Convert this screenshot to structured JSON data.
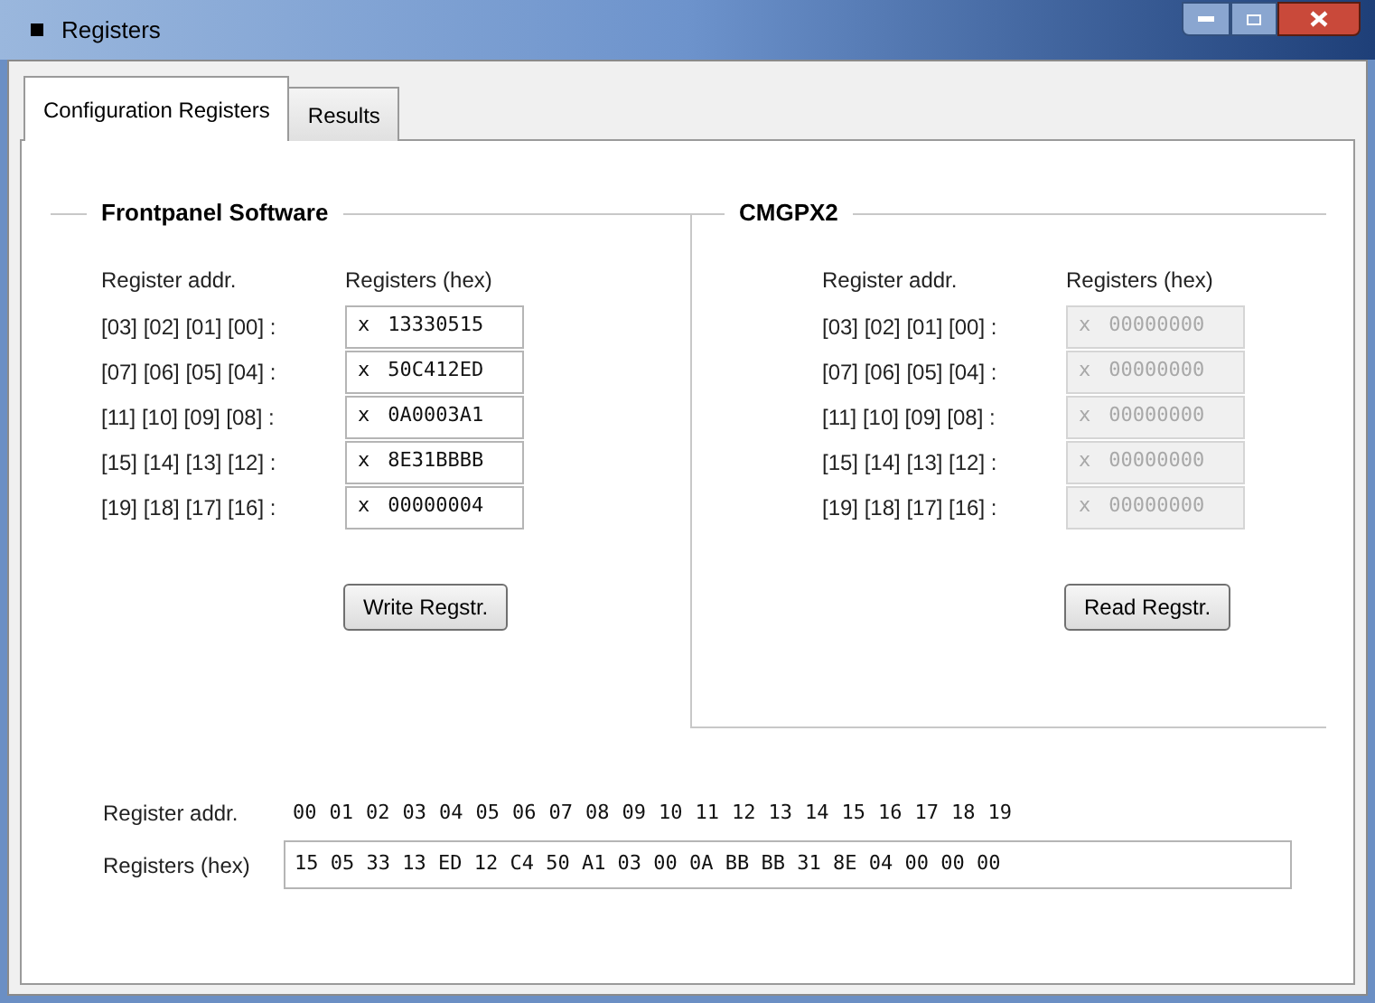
{
  "window": {
    "title": "Registers"
  },
  "tabs": [
    {
      "label": "Configuration Registers",
      "selected": true
    },
    {
      "label": "Results",
      "selected": false
    }
  ],
  "groups": [
    {
      "title": "Frontpanel Software",
      "addr_header": "Register addr.",
      "hex_header": "Registers (hex)",
      "disabled": false,
      "button": "Write Regstr.",
      "rows": [
        {
          "addr": "[03] [02] [01] [00] :",
          "prefix": "x",
          "value": "13330515"
        },
        {
          "addr": "[07] [06] [05] [04] :",
          "prefix": "x",
          "value": "50C412ED"
        },
        {
          "addr": "[11] [10] [09] [08] :",
          "prefix": "x",
          "value": "0A0003A1"
        },
        {
          "addr": "[15] [14] [13] [12] :",
          "prefix": "x",
          "value": "8E31BBBB"
        },
        {
          "addr": "[19] [18] [17] [16] :",
          "prefix": "x",
          "value": "00000004"
        }
      ]
    },
    {
      "title": "CMGPX2",
      "addr_header": "Register addr.",
      "hex_header": "Registers (hex)",
      "disabled": true,
      "button": "Read Regstr.",
      "rows": [
        {
          "addr": "[03] [02] [01] [00] :",
          "prefix": "x",
          "value": "00000000"
        },
        {
          "addr": "[07] [06] [05] [04] :",
          "prefix": "x",
          "value": "00000000"
        },
        {
          "addr": "[11] [10] [09] [08] :",
          "prefix": "x",
          "value": "00000000"
        },
        {
          "addr": "[15] [14] [13] [12] :",
          "prefix": "x",
          "value": "00000000"
        },
        {
          "addr": "[19] [18] [17] [16] :",
          "prefix": "x",
          "value": "00000000"
        }
      ]
    }
  ],
  "dump": {
    "addr_label": "Register addr.",
    "addresses": [
      "00",
      "01",
      "02",
      "03",
      "04",
      "05",
      "06",
      "07",
      "08",
      "09",
      "10",
      "11",
      "12",
      "13",
      "14",
      "15",
      "16",
      "17",
      "18",
      "19"
    ],
    "hex_label": "Registers (hex)",
    "value": "15 05 33 13 ED 12 C4 50 A1 03 00 0A BB BB 31 8E 04 00 00 00"
  }
}
